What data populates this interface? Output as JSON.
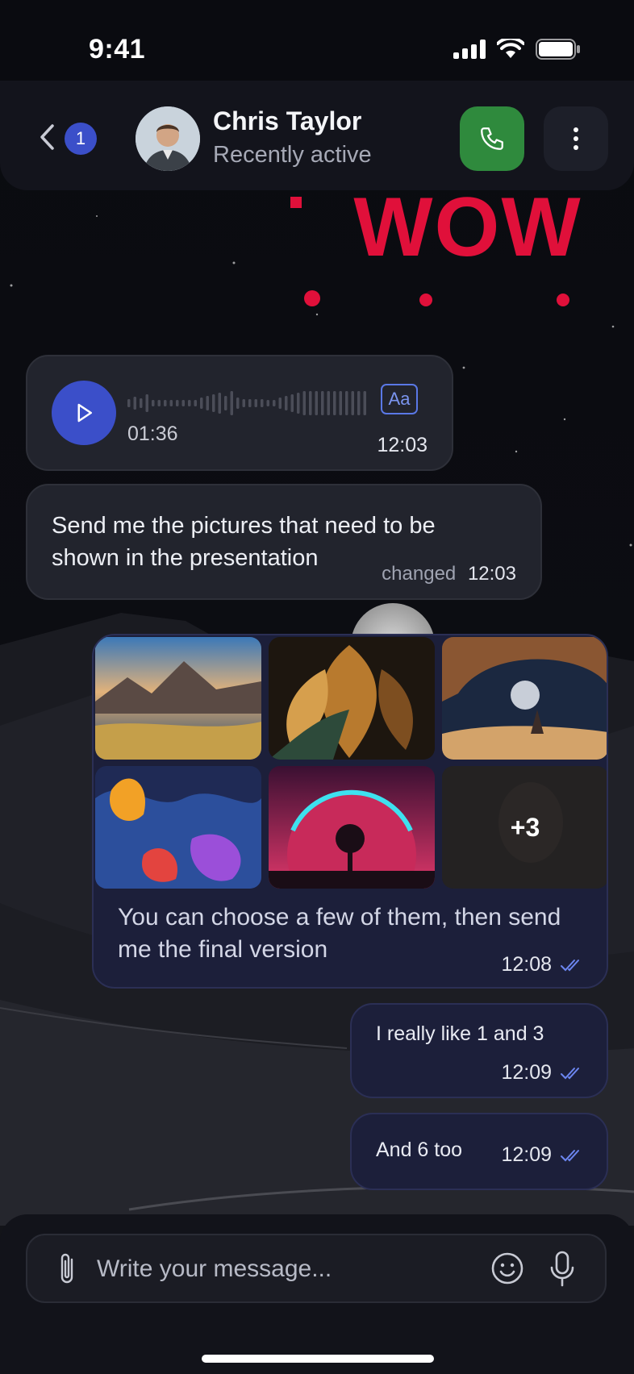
{
  "status_bar": {
    "time": "9:41"
  },
  "header": {
    "unread_count": "1",
    "contact_name": "Chris Taylor",
    "contact_status": "Recently active",
    "call_color": "#2f8a3d",
    "accent_color": "#3b4fc9"
  },
  "sticker": {
    "text": "WOW",
    "color": "#e0103a"
  },
  "messages": {
    "voice": {
      "duration": "01:36",
      "time": "12:03",
      "transcribe_label": "Aa"
    },
    "text_in": {
      "text": "Send me the pictures that need to be shown in the presentation",
      "edited_label": "changed",
      "time": "12:03"
    },
    "gallery": {
      "more_label": "+3",
      "caption": "You can choose a few of them, then send me the final version",
      "time": "12:08"
    },
    "out_1": {
      "text": "I really like 1 and 3",
      "time": "12:09"
    },
    "out_2": {
      "text": "And 6 too",
      "time": "12:09"
    }
  },
  "composer": {
    "placeholder": "Write your message..."
  }
}
